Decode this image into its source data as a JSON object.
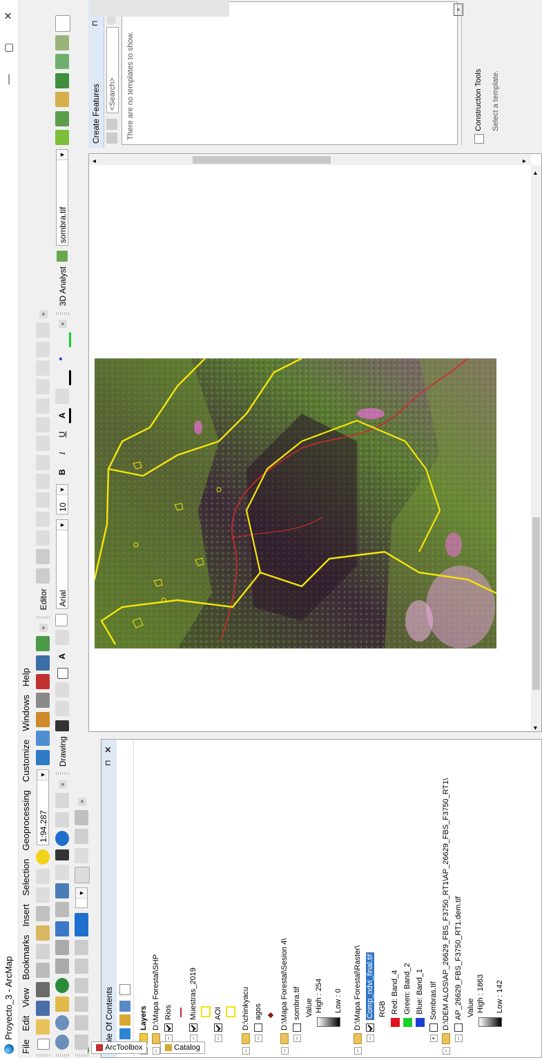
{
  "window": {
    "title": "Proyecto_3 - ArcMap",
    "min": "—",
    "max": "▢",
    "close": "✕"
  },
  "menu": [
    "File",
    "Edit",
    "View",
    "Bookmarks",
    "Insert",
    "Selection",
    "Geoprocessing",
    "Customize",
    "Windows",
    "Help"
  ],
  "toolbar": {
    "scale": "1:94.287",
    "editor": "Editor",
    "drawing": "Drawing",
    "font": "Arial",
    "font_size": "10",
    "bold": "B",
    "italic": "I",
    "underline": "U",
    "analyst": "3D Analyst",
    "layer": "sombra.tif"
  },
  "toc": {
    "title": "Table Of Contents",
    "root": "Layers",
    "rows": {
      "shp": "D:\\Mapa Forestal\\SHP",
      "rios": "Rios",
      "muestras": "Muestras_2019",
      "aoi": "AOI",
      "chinkyacu": "D:\\chinkyacu",
      "agos": "agos",
      "sesion4": "D:\\Mapa Forestal\\Sesion 4\\",
      "sombra": "sombra.tif",
      "value1": "Value",
      "high1": "High : 254",
      "low1": "Low : 0",
      "raster": "D:\\Mapa Forestal\\Raster\\",
      "comp": "Comp_ndvi_final.tif",
      "rgb": "RGB",
      "red": "Red:   Band_4",
      "green": "Green: Band_2",
      "blue": "Blue:   Band_1",
      "sombras": "Sombras.tif",
      "dem": "D:\\DEM ALOS\\AP_26629_FBS_F3750_RT1\\AP_26629_FBS_F3750_RT1\\",
      "demfile": "AP_26629_FBS_F3750_RT1.dem.tif",
      "value2": "Value",
      "high2": "High : 1863",
      "low2": "Low : 142"
    }
  },
  "create_features": {
    "title": "Create Features",
    "search": "<Search>",
    "empty": "There are no templates to show.",
    "construction": "Construction Tools",
    "select": "Select a template."
  },
  "side_tabs": {
    "arctoolbox": "ArcToolbox",
    "catalog": "Catalog"
  },
  "colors": {
    "aoi_outline": "#f5e60a",
    "rivers": "#d2282d",
    "red_band": "#e0141e",
    "green_band": "#19d02a",
    "blue_band": "#1d3fd8",
    "selection": "#3276c8"
  }
}
